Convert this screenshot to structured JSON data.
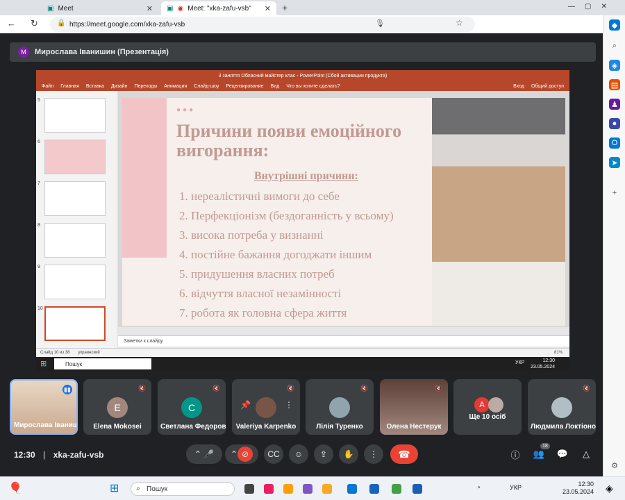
{
  "browser": {
    "tabs": [
      {
        "label": "Meet",
        "active": false
      },
      {
        "label": "Meet: \"xka-zafu-vsb\"",
        "active": true
      }
    ],
    "url": "https://meet.google.com/xka-zafu-vsb"
  },
  "presenter": {
    "initial": "M",
    "name": "Мирослава Іванишин (Презентація)"
  },
  "powerpoint": {
    "window_title": "3 заняття Обласний майстер клас - PowerPoint (Сбой активации продукта)",
    "menu": [
      "Файл",
      "Главная",
      "Вставка",
      "Дизайн",
      "Переходы",
      "Анимация",
      "Слайд-шоу",
      "Рецензирование",
      "Вид",
      "Что вы хотите сделать?"
    ],
    "login": "Вход",
    "share": "Общий доступ",
    "thumbs": [
      {
        "num": "5"
      },
      {
        "num": "6"
      },
      {
        "num": "7"
      },
      {
        "num": "8"
      },
      {
        "num": "9"
      },
      {
        "num": "10"
      }
    ],
    "slide": {
      "title": "Причини появи емоційного вигорання:",
      "subtitle": "Внутрішні причини:",
      "items": [
        "1. нереалістичні вимоги до себе",
        "2. Перфекціонізм (бездоганність у всьому)",
        "3. висока потреба у визнанні",
        "4. постійне бажання догоджати іншим",
        "5. придушення власних потреб",
        "6. відчуття власної незамінності",
        "7. робота як головна сфера життя"
      ]
    },
    "notes": "Заметки к слайду",
    "status": "Слайд 10 из 38",
    "lang": "украинский",
    "zoom": "81%"
  },
  "inner_taskbar": {
    "search": "Пошук",
    "time": "12:30",
    "date": "23.05.2024",
    "lang": "УКР"
  },
  "participants": [
    {
      "name": "Мирослава Іванишин",
      "initial": "",
      "color": "#f0c8a0"
    },
    {
      "name": "Elena Mokosei",
      "initial": "E",
      "color": "#a1887f"
    },
    {
      "name": "Светлана Федорова",
      "initial": "С",
      "color": "#009688"
    },
    {
      "name": "Valeriya Karpenko",
      "initial": "",
      "color": "#795548"
    },
    {
      "name": "Лілія Туренко",
      "initial": "",
      "color": "#90a4ae"
    },
    {
      "name": "Олена Нестерук",
      "initial": "",
      "color": "#8d6e63"
    },
    {
      "name": "Ще 10 осіб",
      "initial": "A",
      "color": "#e53935"
    },
    {
      "name": "Людмила Локтіонова",
      "initial": "",
      "color": "#b0bec5"
    }
  ],
  "controls": {
    "time": "12:30",
    "code": "xka-zafu-vsb",
    "people_count": "18"
  },
  "taskbar": {
    "search": "Пошук",
    "lang": "УКР",
    "time": "12:30",
    "date": "23.05.2024"
  }
}
